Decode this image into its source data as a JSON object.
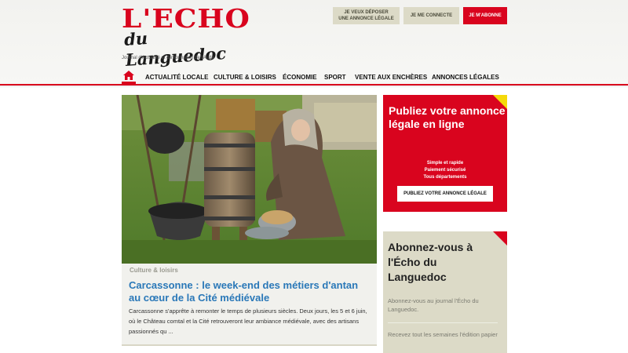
{
  "logo": {
    "echo": "L'ECHO",
    "sub": "du Languedoc"
  },
  "tagline": "Journal d'Actualité et d'information de l'Aude",
  "header_buttons": {
    "depot_line1": "JE VEUX DÉPOSER",
    "depot_line2": "UNE ANNONCE LÉGALE",
    "login": "JE ME CONNECTE",
    "subscribe": "JE M'ABONNE"
  },
  "nav": {
    "items": [
      "ACTUALITÉ LOCALE",
      "CULTURE & LOISIRS",
      "ÉCONOMIE",
      "SPORT",
      "VENTE AUX ENCHÈRES",
      "ANNONCES LÉGALES"
    ]
  },
  "article": {
    "category": "Culture & loisirs",
    "title": "Carcassonne : le week-end des métiers d'antan au cœur de la Cité médiévale",
    "excerpt": "Carcassonne s'apprête à remonter le temps de plusieurs siècles. Deux jours, les 5 et 6 juin, où le Château comtal et la Cité retrouveront leur ambiance médiévale, avec des artisans passionnés qu ..."
  },
  "promo": {
    "title": "Publiez votre annonce légale en ligne",
    "features": [
      "Simple et rapide",
      "Paiement sécurisé",
      "Tous départements"
    ],
    "button": "PUBLIEZ VOTRE ANNONCE LÉGALE"
  },
  "subscribe_box": {
    "title": "Abonnez-vous à l'Écho du Languedoc",
    "p1": "Abonnez-vous au journal l'Écho du Languedoc.",
    "p2": "Recevez tout les semaines l'édition papier"
  },
  "colors": {
    "brand_red": "#d9041e",
    "beige": "#dcdac7",
    "link_blue": "#2a78b8"
  }
}
